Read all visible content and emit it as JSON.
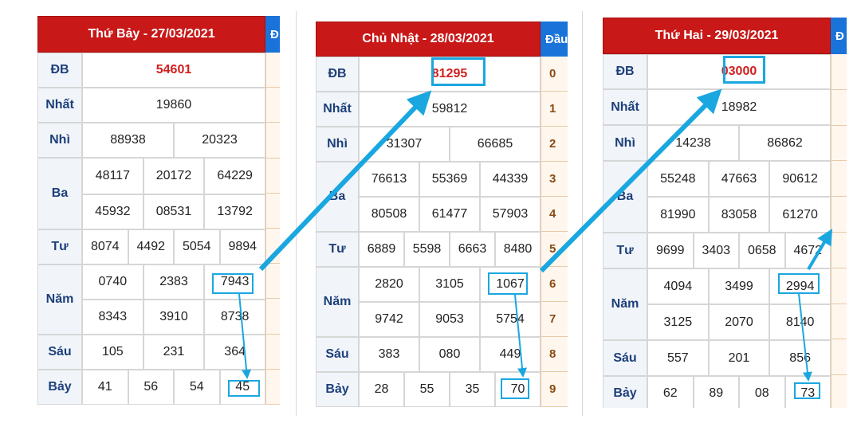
{
  "panels": [
    {
      "title": "Thứ Bảy - 27/03/2021",
      "side_header": "Đ",
      "side_digits": [],
      "labels": {
        "db": "ĐB",
        "nhat": "Nhất",
        "nhi": "Nhì",
        "ba": "Ba",
        "tu": "Tư",
        "nam": "Năm",
        "sau": "Sáu",
        "bay": "Bảy"
      },
      "db": "54601",
      "nhat": "19860",
      "nhi": [
        "88938",
        "20323"
      ],
      "ba": [
        [
          "48117",
          "20172",
          "64229"
        ],
        [
          "45932",
          "08531",
          "13792"
        ]
      ],
      "tu": [
        "8074",
        "4492",
        "5054",
        "9894"
      ],
      "nam": [
        [
          "0740",
          "2383",
          "7943"
        ],
        [
          "8343",
          "3910",
          "8738"
        ]
      ],
      "sau": [
        "105",
        "231",
        "364"
      ],
      "bay": [
        "41",
        "56",
        "54",
        "45"
      ]
    },
    {
      "title": "Chủ Nhật - 28/03/2021",
      "side_header": "Đầu",
      "side_digits": [
        "0",
        "1",
        "2",
        "3",
        "4",
        "5",
        "6",
        "7",
        "8",
        "9"
      ],
      "labels": {
        "db": "ĐB",
        "nhat": "Nhất",
        "nhi": "Nhì",
        "ba": "Ba",
        "tu": "Tư",
        "nam": "Năm",
        "sau": "Sáu",
        "bay": "Bảy"
      },
      "db": "81295",
      "nhat": "59812",
      "nhi": [
        "31307",
        "66685"
      ],
      "ba": [
        [
          "76613",
          "55369",
          "44339"
        ],
        [
          "80508",
          "61477",
          "57903"
        ]
      ],
      "tu": [
        "6889",
        "5598",
        "6663",
        "8480"
      ],
      "nam": [
        [
          "2820",
          "3105",
          "1067"
        ],
        [
          "9742",
          "9053",
          "5754"
        ]
      ],
      "sau": [
        "383",
        "080",
        "449"
      ],
      "bay": [
        "28",
        "55",
        "35",
        "70"
      ]
    },
    {
      "title": "Thứ Hai - 29/03/2021",
      "side_header": "Đ",
      "side_digits": [],
      "labels": {
        "db": "ĐB",
        "nhat": "Nhất",
        "nhi": "Nhì",
        "ba": "Ba",
        "tu": "Tư",
        "nam": "Năm",
        "sau": "Sáu",
        "bay": "Bảy"
      },
      "db": "03000",
      "nhat": "18982",
      "nhi": [
        "14238",
        "86862"
      ],
      "ba": [
        [
          "55248",
          "47663",
          "90612"
        ],
        [
          "81990",
          "83058",
          "61270"
        ]
      ],
      "tu": [
        "9699",
        "3403",
        "0658",
        "4672"
      ],
      "nam": [
        [
          "4094",
          "3499",
          "2994"
        ],
        [
          "3125",
          "2070",
          "8140"
        ]
      ],
      "sau": [
        "557",
        "201",
        "856"
      ],
      "bay": [
        "62",
        "89",
        "08",
        "73"
      ]
    }
  ],
  "colors": {
    "header_red": "#c81818",
    "accent_blue": "#1aa7e0",
    "special_red": "#d21f1f"
  }
}
